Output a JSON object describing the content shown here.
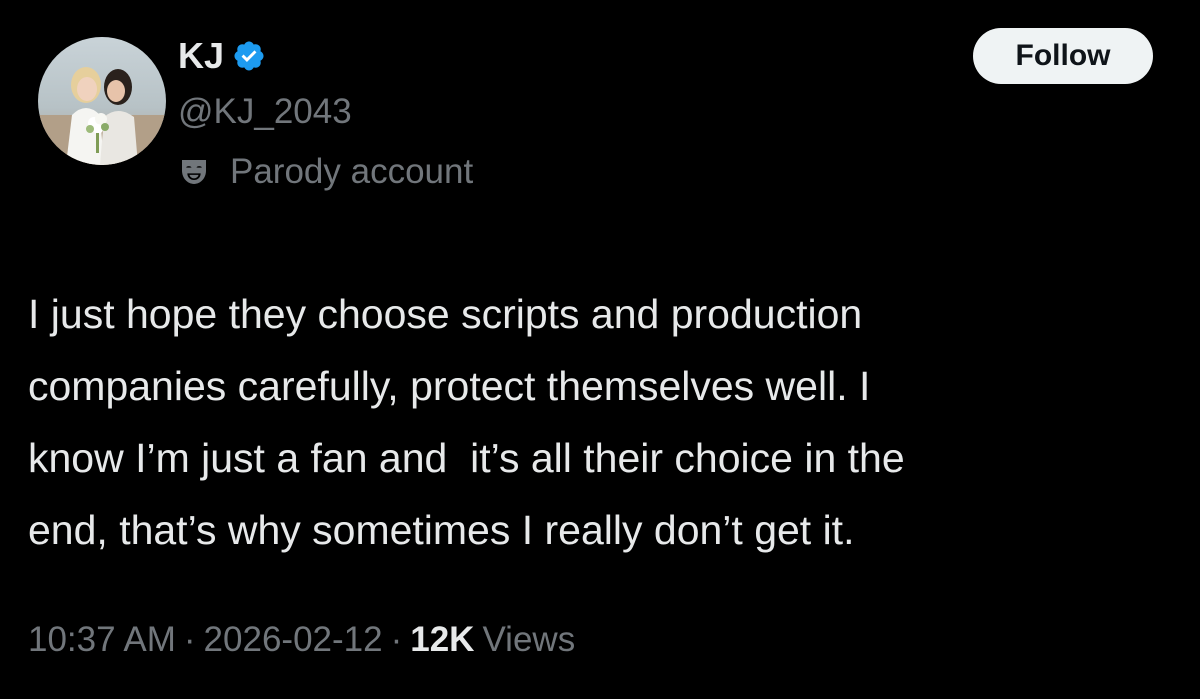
{
  "author": {
    "display_name": "KJ",
    "handle": "@KJ_2043",
    "account_label": "Parody account",
    "verified_icon": "verified-badge-icon",
    "label_icon": "parody-mask-icon",
    "avatar_icon": "avatar-photo"
  },
  "actions": {
    "follow_label": "Follow"
  },
  "tweet": {
    "text": "I just hope they choose scripts and production\ncompanies carefully, protect themselves well. I\nknow I’m just a fan and  it’s all their choice in the\nend, that’s why sometimes I really don’t get it."
  },
  "meta": {
    "time": "10:37 AM",
    "separator": "·",
    "date": "2026-02-12",
    "views_count": "12K",
    "views_label": "Views"
  },
  "colors": {
    "background": "#000000",
    "text_primary": "#e7e9ea",
    "text_secondary": "#71767b",
    "verified_blue": "#1d9bf0",
    "follow_bg": "#eff3f4",
    "follow_text": "#0f1419"
  }
}
